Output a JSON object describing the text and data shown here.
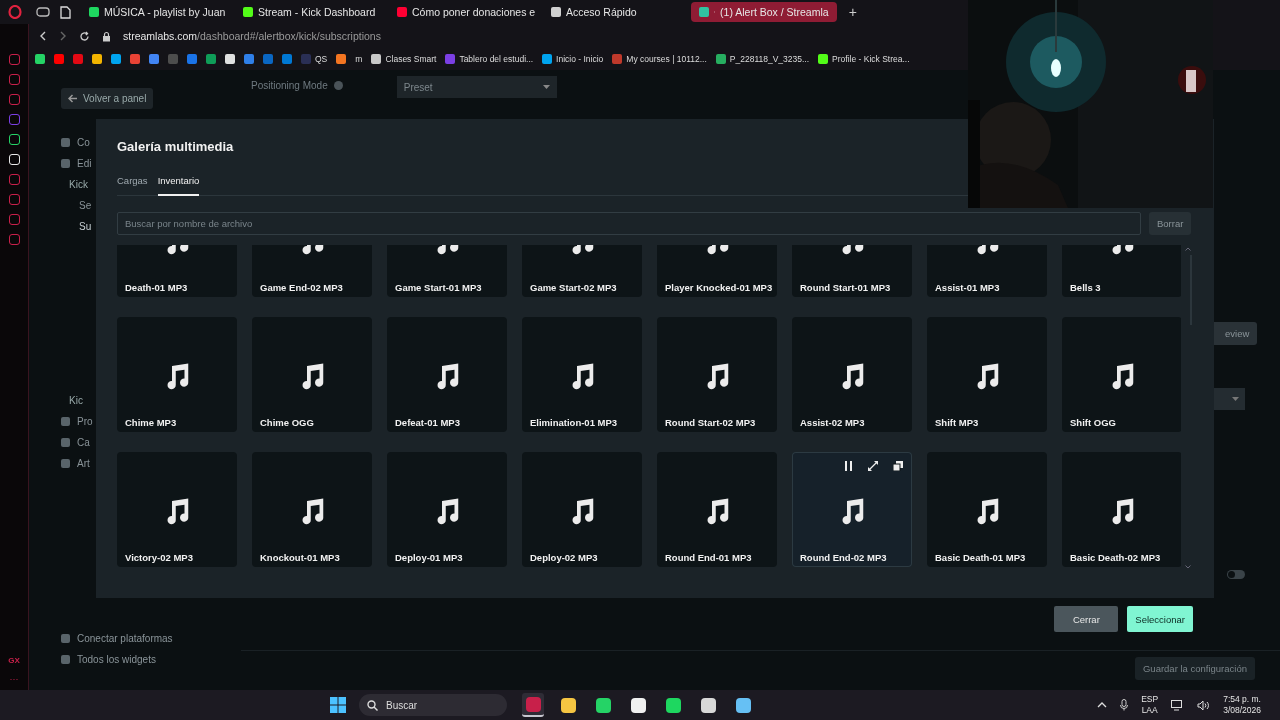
{
  "browser": {
    "tabs": [
      {
        "title": "MÚSICA - playlist by Juan",
        "color": "#1ed760",
        "selected": false
      },
      {
        "title": "Stream - Kick Dashboard",
        "color": "#53fc18",
        "selected": false
      },
      {
        "title": "Cómo poner donaciones e",
        "color": "#ff0033",
        "selected": false
      },
      {
        "title": "Acceso Rápido",
        "color": "#d0d0d0",
        "selected": false
      },
      {
        "title": "(1) Alert Box / Streamla",
        "color": "#31c3a2",
        "selected": true
      }
    ],
    "new_tab": "+",
    "address": {
      "host": "streamlabs.com",
      "path": "/dashboard#/alertbox/kick/subscriptions"
    },
    "bookmarks": [
      {
        "color": "#25d366"
      },
      {
        "color": "#ff0000"
      },
      {
        "color": "#e50914"
      },
      {
        "color": "#f4b400"
      },
      {
        "color": "#00a4ef"
      },
      {
        "color": "#ea4335"
      },
      {
        "color": "#4285f4"
      },
      {
        "color": "#4d4d4d"
      },
      {
        "color": "#1a73e8"
      },
      {
        "color": "#0f9d58"
      },
      {
        "color": "#e0e0e0"
      },
      {
        "color": "#2f7fe8"
      },
      {
        "color": "#0a66c2"
      },
      {
        "color": "#0078d4"
      },
      {
        "label": "QS",
        "color": "#2a2f55"
      },
      {
        "color": "#f47521"
      },
      {
        "label": "m"
      },
      {
        "label": "Clases Smart",
        "color": "#c8c8c8"
      },
      {
        "label": "Tablero del estudi...",
        "color": "#7b3fe4"
      },
      {
        "label": "Inicio - Inicio",
        "color": "#00a4ef"
      },
      {
        "label": "My courses | 10112...",
        "color": "#c0392b"
      },
      {
        "label": "P_228118_V_3235...",
        "color": "#27ae60"
      },
      {
        "label": "Profile - Kick Strea...",
        "color": "#53fc18"
      }
    ]
  },
  "opera_sidebar": {
    "icons": [
      {
        "color": "#c8204a"
      },
      {
        "color": "#c8204a"
      },
      {
        "color": "#c8204a"
      },
      {
        "color": "#7b3fe4"
      },
      {
        "color": "#25d366"
      },
      {
        "color": "#e8e8e8"
      },
      {
        "color": "#c8204a"
      },
      {
        "color": "#c8204a"
      },
      {
        "color": "#c8204a"
      },
      {
        "color": "#c8204a"
      }
    ],
    "badge": "GX",
    "more": "···"
  },
  "page": {
    "back_button": "Volver a panel",
    "nav_top": [
      {
        "label": "Co",
        "kind": "link",
        "selected": false
      },
      {
        "label": "Edi",
        "kind": "link",
        "selected": false
      },
      {
        "label": "Kick",
        "kind": "heading",
        "selected": false
      },
      {
        "label": "Se",
        "kind": "sublink",
        "selected": false
      },
      {
        "label": "Su",
        "kind": "sublink",
        "selected": true
      }
    ],
    "nav_middle": [
      {
        "label": "Kic",
        "kind": "heading",
        "selected": false
      },
      {
        "label": "Pro",
        "kind": "link",
        "selected": false
      },
      {
        "label": "Ca",
        "kind": "link",
        "selected": false
      },
      {
        "label": "Art",
        "kind": "link",
        "selected": false
      }
    ],
    "nav_bottom": [
      {
        "label": "Conectar plataformas"
      },
      {
        "label": "Todos los widgets"
      }
    ],
    "positioning_label": "Positioning Mode",
    "positioning_value": "Preset",
    "preview_button": "eview",
    "toggle_on": false,
    "save_button": {
      "label": "Guardar la configuración",
      "disabled": true
    }
  },
  "modal": {
    "title": "Galería multimedia",
    "tabs": [
      {
        "label": "Cargas",
        "selected": false
      },
      {
        "label": "Inventario",
        "selected": true
      }
    ],
    "search": {
      "placeholder": "Buscar por nombre de archivo"
    },
    "clear_button": "Borrar",
    "files": [
      {
        "name": "Death-01 MP3",
        "hovered": false
      },
      {
        "name": "Game End-02 MP3",
        "hovered": false
      },
      {
        "name": "Game Start-01 MP3",
        "hovered": false
      },
      {
        "name": "Game Start-02 MP3",
        "hovered": false
      },
      {
        "name": "Player Knocked-01 MP3",
        "hovered": false
      },
      {
        "name": "Round Start-01 MP3",
        "hovered": false
      },
      {
        "name": "Assist-01 MP3",
        "hovered": false
      },
      {
        "name": "Bells 3",
        "hovered": false
      },
      {
        "name": "Chime MP3",
        "hovered": false
      },
      {
        "name": "Chime OGG",
        "hovered": false
      },
      {
        "name": "Defeat-01 MP3",
        "hovered": false
      },
      {
        "name": "Elimination-01 MP3",
        "hovered": false
      },
      {
        "name": "Round Start-02 MP3",
        "hovered": false
      },
      {
        "name": "Assist-02 MP3",
        "hovered": false
      },
      {
        "name": "Shift MP3",
        "hovered": false
      },
      {
        "name": "Shift OGG",
        "hovered": false
      },
      {
        "name": "Victory-02 MP3",
        "hovered": false
      },
      {
        "name": "Knockout-01 MP3",
        "hovered": false
      },
      {
        "name": "Deploy-01 MP3",
        "hovered": false
      },
      {
        "name": "Deploy-02 MP3",
        "hovered": false
      },
      {
        "name": "Round End-01 MP3",
        "hovered": false
      },
      {
        "name": "Round End-02 MP3",
        "hovered": true
      },
      {
        "name": "Basic Death-01 MP3",
        "hovered": false
      },
      {
        "name": "Basic Death-02 MP3",
        "hovered": false
      }
    ],
    "buttons": [
      {
        "label": "Cerrar",
        "kind": "secondary"
      },
      {
        "label": "Seleccionar",
        "kind": "primary"
      }
    ]
  },
  "taskbar": {
    "search": "Buscar",
    "apps": [
      {
        "color": "#c8204a",
        "selected": true
      },
      {
        "color": "#f5c542",
        "selected": false
      },
      {
        "color": "#25d366",
        "selected": false
      },
      {
        "color": "#f0f0f0",
        "selected": false
      },
      {
        "color": "#1ed760",
        "selected": false
      },
      {
        "color": "#d8d8d8",
        "selected": false
      },
      {
        "color": "#66c0f4",
        "selected": false
      }
    ],
    "language": "ESP",
    "layout": "LAA",
    "time": "7:54 p. m.",
    "date": "3/08/2026"
  }
}
